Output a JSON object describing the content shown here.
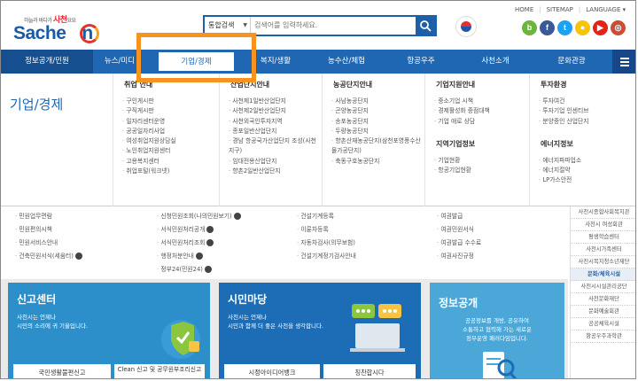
{
  "header": {
    "logo_sub": "하늘과 바다가 ",
    "logo_sub_brand": "사천",
    "logo_sub_tail": "요요",
    "logo_text": "Sache",
    "logo_text_tail": "n",
    "search_type": "통합검색",
    "search_placeholder": "검색어를 입력하세요.",
    "toplinks": [
      "HOME",
      "SITEMAP",
      "LANGUAGE ▾"
    ],
    "social": [
      {
        "icon": "blog-icon",
        "glyph": "b",
        "color": "#6cb33f"
      },
      {
        "icon": "facebook-icon",
        "glyph": "f",
        "color": "#3b5998"
      },
      {
        "icon": "twitter-icon",
        "glyph": "t",
        "color": "#1da1f2"
      },
      {
        "icon": "kakaostory-icon",
        "glyph": "●",
        "color": "#f7c600"
      },
      {
        "icon": "youtube-icon",
        "glyph": "▶",
        "color": "#e62117"
      },
      {
        "icon": "instagram-icon",
        "glyph": "◎",
        "color": "#d04a36"
      }
    ]
  },
  "gnb": {
    "items": [
      "정보공개/민원",
      "뉴스/미디",
      "기업/경제",
      "복지/생활",
      "농수산/체험",
      "항공우주",
      "사천소개",
      "문화관광"
    ]
  },
  "mega": {
    "title": "기업/경제",
    "columns": [
      {
        "heading": "취업 안내",
        "items": [
          "구인게시판",
          "구직게시판",
          "일자리센터운영",
          "공공일자리사업",
          "여성취업지원상담실",
          "노인취업지원센터",
          "고용복지센터",
          "취업포털(워크넷)"
        ]
      },
      {
        "heading": "산업단지안내",
        "items": [
          "사천제1일반산업단지",
          "사천제2일반산업단지",
          "사천외국인투자지역",
          "종포일반산업단지",
          "경남 항공국가산업단지 조성(사천지구)",
          "임대전용산업단지",
          "향촌2일반산업단지"
        ]
      },
      {
        "heading": "농공단지안내",
        "items": [
          "사남농공단지",
          "곤양농공단지",
          "송포농공단지",
          "두량농공단지",
          "향촌산재농공단지(삼천포영풍수산물가공단지)",
          "축동구호농공단지"
        ]
      },
      {
        "heading": "기업지원안내",
        "items": [
          "중소기업 시책",
          "경제활성화 중점대책",
          "기업 애로 상담"
        ]
      },
      {
        "heading": "투자환경",
        "items": [
          "투자여건",
          "투자기업 인센티브",
          "분양중인 산업단지"
        ]
      }
    ],
    "col4_heading2": "지역기업정보",
    "col4_items2": [
      "기업현황",
      "항공기업현황"
    ],
    "col5_heading2": "에너지정보",
    "col5_items2": [
      "에너지파파업소",
      "에너지절약",
      "LP가스안전"
    ]
  },
  "lists": [
    [
      "민원업무편람",
      "민원편의시책",
      "민원서비스안내",
      "건축민원서식(세움터)"
    ],
    [
      "신청민원조회(나의민원보기)",
      "서식민원처리공개",
      "서식민원처리조회",
      "행정처분안내",
      "정부24(민원24)"
    ],
    [
      "건설기계등록",
      "이륜차등록",
      "자동차검사(의무보험)",
      "건설기계정기검사안내"
    ],
    [
      "여권발급",
      "여권민원서식",
      "여권발급 수수료",
      "여권사진규정"
    ]
  ],
  "side": [
    "사천시종합사회복지관",
    "사천시 여성회관",
    "평생학습센터",
    "사천시가족센터",
    "사천시복지청소년재단",
    "문화/체육시설",
    "사천시시설관리공단",
    "사천문화재단",
    "문화예술회관",
    "공공체육시설",
    "항공우주과학관"
  ],
  "cards": [
    {
      "title": "신고센터",
      "desc1": "사천시는 언제나",
      "desc2": "시민의 소리에 귀 기울입니다.",
      "bar1": "국민생활불편신고",
      "bar2": "Clean 신고 및 공무원부조리신고"
    },
    {
      "title": "시민마당",
      "desc1": "사천시는 언제나",
      "desc2": "시민과 함께 더 좋은 사천을 생각합니다.",
      "bar1": "시정아이디어뱅크",
      "bar2": "칭찬합시다"
    },
    {
      "title": "정보공개",
      "desc1": "공공정보를 개방, 공유하여",
      "desc2": "소통하고 협력해 가는 새로운",
      "desc3": "정부운영 패러다임입니다."
    }
  ],
  "colors": {
    "primary": "#1f66b3",
    "highlight": "#f7931e",
    "card1": "#2d8fca",
    "card2": "#1c6db5",
    "card3": "#4aa7d8"
  }
}
